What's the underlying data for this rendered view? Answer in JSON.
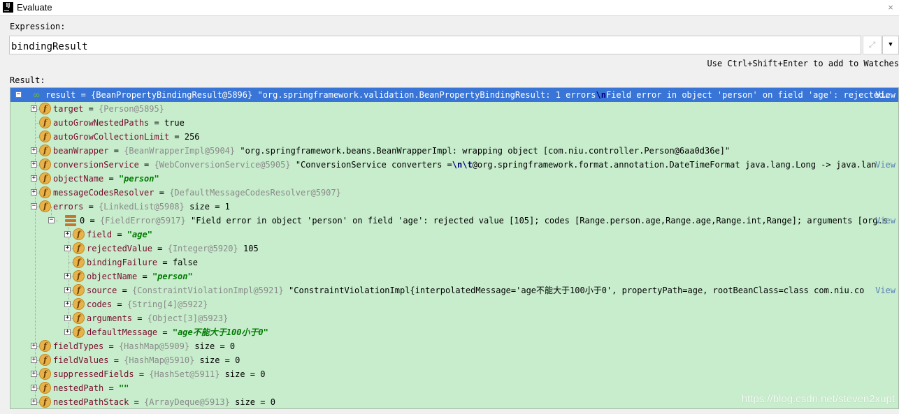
{
  "window": {
    "app_icon": "IJ",
    "title": "Evaluate",
    "close_glyph": "×"
  },
  "expression": {
    "label": "Expression:",
    "value": "bindingResult",
    "expand_glyph": "⤢",
    "dropdown_glyph": "▼"
  },
  "hint": "Use Ctrl+Shift+Enter to add to Watches",
  "result_label": "Result:",
  "tree": {
    "view_label": "View",
    "root": {
      "toggle": "−",
      "text_plain": "result = ",
      "id": "{BeanPropertyBindingResult@5896}",
      "value_a": " \"org.springframework.validation.BeanPropertyBindingResult: 1 errors",
      "esc": "\\n",
      "value_b": "Field error in object 'person' on field 'age': rejected… ",
      "view": "View"
    },
    "rows": [
      {
        "name": "target",
        "eq": " = ",
        "id": "{Person@5895}",
        "val": "",
        "gval": "",
        "toggle": "+"
      },
      {
        "name": "autoGrowNestedPaths",
        "eq": " = ",
        "id": "",
        "val": "true",
        "gval": "",
        "toggle": ""
      },
      {
        "name": "autoGrowCollectionLimit",
        "eq": " = ",
        "id": "",
        "val": "256",
        "gval": "",
        "toggle": ""
      },
      {
        "name": "beanWrapper",
        "eq": " = ",
        "id": "{BeanWrapperImpl@5904}",
        "val": " \"org.springframework.beans.BeanWrapperImpl: wrapping object [com.niu.controller.Person@6aa0d36e]\"",
        "gval": "",
        "toggle": "+"
      },
      {
        "name": "conversionService",
        "eq": " = ",
        "id": "{WebConversionService@5905}",
        "val": " \"ConversionService converters =",
        "esc": "\\n\\t",
        "val2": "@org.springframework.format.annotation.DateTimeFormat java.lang.Long -> java.lan",
        "gval": "",
        "toggle": "+",
        "view": "View"
      },
      {
        "name": "objectName",
        "eq": " = ",
        "id": "",
        "val": "",
        "gval": "\"person\"",
        "toggle": "+"
      },
      {
        "name": "messageCodesResolver",
        "eq": " = ",
        "id": "{DefaultMessageCodesResolver@5907}",
        "val": "",
        "gval": "",
        "toggle": "+"
      },
      {
        "name": "errors",
        "eq": " = ",
        "id": "{LinkedList@5908}",
        "val": "  size = 1",
        "gval": "",
        "toggle": "−"
      }
    ],
    "error_item": {
      "toggle": "−",
      "index": "0",
      "eq": " = ",
      "id": "{FieldError@5917}",
      "val": " \"Field error in object 'person' on field 'age': rejected value [105]; codes [Range.person.age,Range.age,Range.int,Range]; arguments [org.s",
      "view": "View"
    },
    "error_fields": [
      {
        "name": "field",
        "eq": " = ",
        "id": "",
        "val": "",
        "gval": "\"age\"",
        "toggle": "+"
      },
      {
        "name": "rejectedValue",
        "eq": " = ",
        "id": "{Integer@5920}",
        "val": " 105",
        "gval": "",
        "toggle": "+"
      },
      {
        "name": "bindingFailure",
        "eq": " = ",
        "id": "",
        "val": "false",
        "gval": "",
        "toggle": ""
      },
      {
        "name": "objectName",
        "eq": " = ",
        "id": "",
        "val": "",
        "gval": "\"person\"",
        "toggle": "+"
      },
      {
        "name": "source",
        "eq": " = ",
        "id": "{ConstraintViolationImpl@5921}",
        "val": " \"ConstraintViolationImpl{interpolatedMessage='age不能大于100小于0', propertyPath=age, rootBeanClass=class com.niu.co",
        "gval": "",
        "toggle": "+",
        "view": "View"
      },
      {
        "name": "codes",
        "eq": " = ",
        "id": "{String[4]@5922}",
        "val": "",
        "gval": "",
        "toggle": "+"
      },
      {
        "name": "arguments",
        "eq": " = ",
        "id": "{Object[3]@5923}",
        "val": "",
        "gval": "",
        "toggle": "+"
      },
      {
        "name": "defaultMessage",
        "eq": " = ",
        "id": "",
        "val": "",
        "gval": "\"age不能大于100小于0\"",
        "toggle": "+"
      }
    ],
    "tail_rows": [
      {
        "name": "fieldTypes",
        "eq": " = ",
        "id": "{HashMap@5909}",
        "val": "  size = 0",
        "gval": "",
        "toggle": "+"
      },
      {
        "name": "fieldValues",
        "eq": " = ",
        "id": "{HashMap@5910}",
        "val": "  size = 0",
        "gval": "",
        "toggle": "+"
      },
      {
        "name": "suppressedFields",
        "eq": " = ",
        "id": "{HashSet@5911}",
        "val": "  size = 0",
        "gval": "",
        "toggle": "+"
      },
      {
        "name": "nestedPath",
        "eq": " = ",
        "id": "",
        "val": "",
        "gval": "\"\"",
        "toggle": "+"
      },
      {
        "name": "nestedPathStack",
        "eq": " = ",
        "id": "{ArrayDeque@5913}",
        "val": "  size = 0",
        "gval": "",
        "toggle": "+"
      }
    ]
  },
  "watermark": "https://blog.csdn.net/steven2xupt"
}
